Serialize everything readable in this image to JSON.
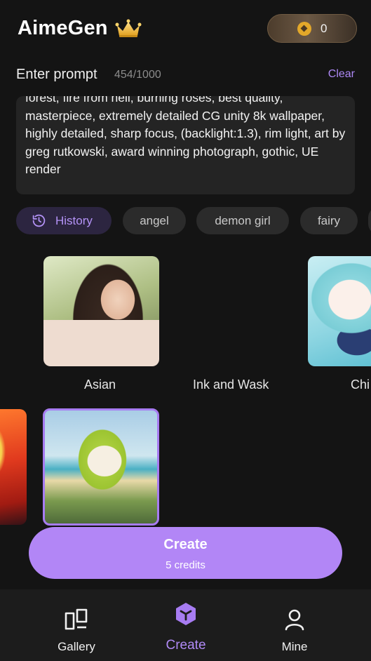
{
  "header": {
    "title": "AimeGen",
    "crown_icon": "crown-icon",
    "credits": "0",
    "coin_icon": "coin-icon"
  },
  "prompt": {
    "label": "Enter prompt",
    "count": "454/1000",
    "clear_label": "Clear",
    "text": "forest, fire from hell, burning roses, best quality, masterpiece, extremely detailed CG unity 8k wallpaper, highly detailed, sharp focus, (backlight:1.3), rim light, art by greg rutkowski, award winning photograph, gothic, UE render"
  },
  "chips": [
    {
      "label": "History",
      "icon": "history-icon",
      "active": true
    },
    {
      "label": "angel"
    },
    {
      "label": "demon girl"
    },
    {
      "label": "fairy"
    }
  ],
  "styles": [
    {
      "label": "Asian"
    },
    {
      "label": "Ink and Wask"
    },
    {
      "label": "Chi"
    }
  ],
  "create": {
    "label": "Create",
    "credits": "5 credits"
  },
  "nav": [
    {
      "label": "Gallery",
      "icon": "gallery-icon"
    },
    {
      "label": "Create",
      "icon": "create-cube-icon",
      "active": true
    },
    {
      "label": "Mine",
      "icon": "person-icon"
    }
  ],
  "colors": {
    "accent": "#b286f6",
    "background": "#141414"
  }
}
